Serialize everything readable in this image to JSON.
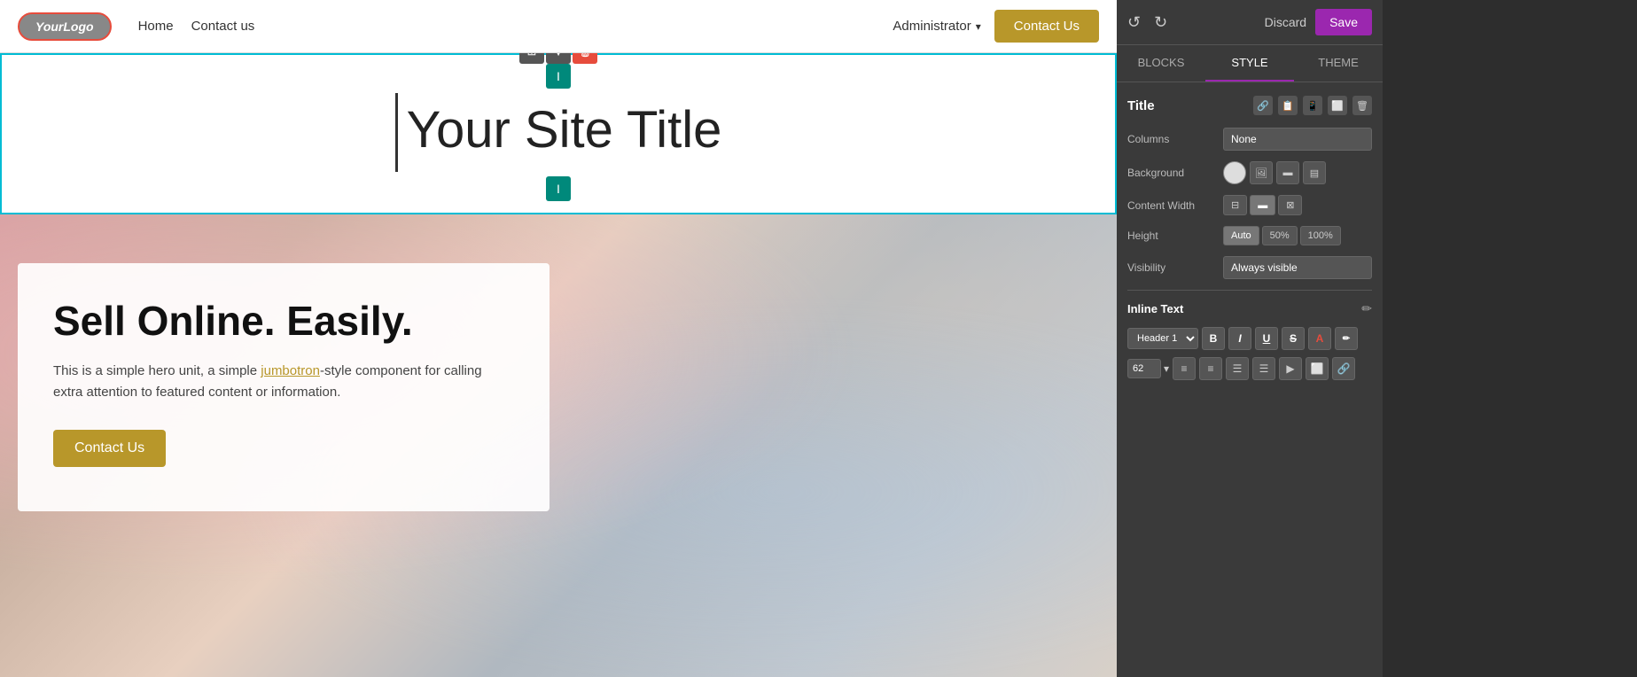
{
  "navbar": {
    "logo_text": "YourLogo",
    "nav_links": [
      {
        "label": "Home",
        "id": "home"
      },
      {
        "label": "Contact us",
        "id": "contact-us"
      }
    ],
    "admin_label": "Administrator",
    "contact_btn": "Contact Us"
  },
  "title_block": {
    "site_title": "Your Site Title",
    "cursor_char": "I"
  },
  "hero": {
    "title": "Sell Online. Easily.",
    "description_part1": "This is a simple hero unit, a simple ",
    "description_link": "jumbotron",
    "description_part2": "-style component for calling extra attention to featured content or information.",
    "contact_btn": "Contact Us"
  },
  "toolbar": {
    "grid_icon": "⊞",
    "down_icon": "▼",
    "delete_icon": "🗑",
    "cursor_char": "I"
  },
  "right_panel": {
    "header": {
      "refresh_icon": "↺",
      "redo_icon": "↻",
      "discard_label": "Discard",
      "save_label": "Save"
    },
    "tabs": [
      {
        "label": "BLOCKS",
        "id": "blocks"
      },
      {
        "label": "STYLE",
        "id": "style",
        "active": true
      },
      {
        "label": "THEME",
        "id": "theme"
      }
    ],
    "title_section": {
      "label": "Title",
      "icons": [
        "🔗",
        "📋",
        "📱",
        "⬜",
        "🗑"
      ]
    },
    "properties": {
      "columns": {
        "label": "Columns",
        "value": "None"
      },
      "background": {
        "label": "Background"
      },
      "content_width": {
        "label": "Content Width",
        "options": [
          "narrow",
          "medium",
          "wide"
        ]
      },
      "height": {
        "label": "Height",
        "options": [
          "Auto",
          "50%",
          "100%"
        ],
        "active": "Auto"
      },
      "visibility": {
        "label": "Visibility",
        "value": "Always visible"
      }
    },
    "inline_text": {
      "label": "Inline Text",
      "edit_icon": "✏"
    },
    "text_format": {
      "style_select": "Header 1",
      "font_size": "62",
      "buttons": [
        {
          "label": "B",
          "id": "bold"
        },
        {
          "label": "I",
          "id": "italic"
        },
        {
          "label": "U",
          "id": "underline"
        },
        {
          "label": "S",
          "id": "strikethrough"
        },
        {
          "label": "A",
          "id": "color"
        }
      ],
      "align_buttons": [
        "≡",
        "≡",
        "≡",
        "≡"
      ],
      "list_buttons": [
        "≡",
        "≡"
      ],
      "extra_buttons": [
        "▶",
        "⬜",
        "🔗"
      ]
    }
  }
}
